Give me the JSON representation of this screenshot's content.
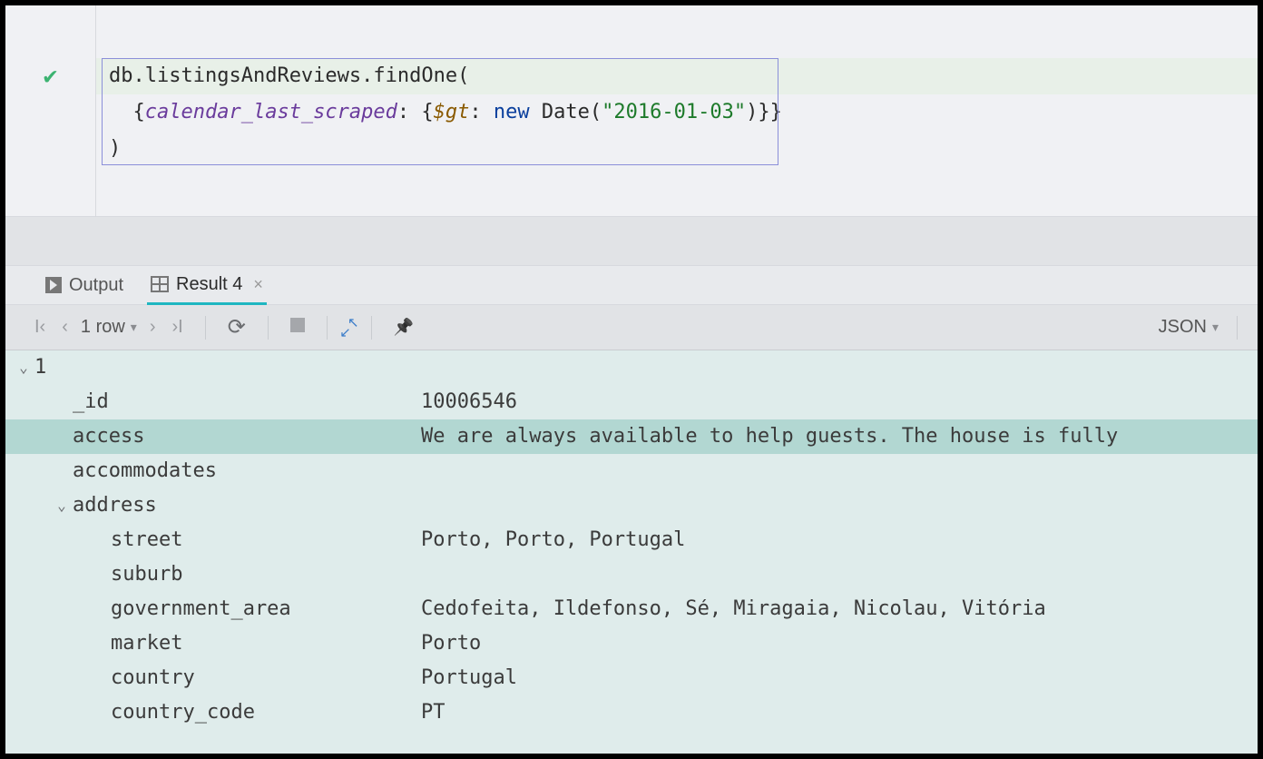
{
  "editor": {
    "code_lines": [
      {
        "segments": [
          {
            "t": "db",
            "c": "tok-id"
          },
          {
            "t": ".",
            "c": "tok-punc"
          },
          {
            "t": "listingsAndReviews",
            "c": "tok-id"
          },
          {
            "t": ".",
            "c": "tok-punc"
          },
          {
            "t": "findOne",
            "c": "tok-method"
          },
          {
            "t": "(",
            "c": "tok-punc"
          }
        ],
        "highlight": true
      },
      {
        "segments": [
          {
            "t": "  {",
            "c": "tok-punc"
          },
          {
            "t": "calendar_last_scraped",
            "c": "tok-field"
          },
          {
            "t": ": {",
            "c": "tok-punc"
          },
          {
            "t": "$gt",
            "c": "tok-op"
          },
          {
            "t": ": ",
            "c": "tok-punc"
          },
          {
            "t": "new ",
            "c": "tok-kw"
          },
          {
            "t": "Date",
            "c": "tok-call"
          },
          {
            "t": "(",
            "c": "tok-punc"
          },
          {
            "t": "\"2016-01-03\"",
            "c": "tok-str"
          },
          {
            "t": ")}}",
            "c": "tok-punc"
          }
        ],
        "highlight": false
      },
      {
        "segments": [
          {
            "t": ")",
            "c": "tok-punc"
          }
        ],
        "highlight": false
      }
    ]
  },
  "tabs": {
    "output_label": "Output",
    "result_label": "Result 4"
  },
  "toolbar": {
    "row_count_label": "1 row",
    "view_mode": "JSON"
  },
  "tree": {
    "root_index": "1",
    "rows": [
      {
        "indent": 1,
        "key": "_id",
        "value": "10006546",
        "selected": false
      },
      {
        "indent": 1,
        "key": "access",
        "value": "We are always available to help guests. The house is fully",
        "selected": true
      },
      {
        "indent": 1,
        "key": "accommodates",
        "value": "",
        "selected": false
      },
      {
        "indent": 1,
        "key": "address",
        "value": "",
        "selected": false,
        "expander": "open"
      },
      {
        "indent": 2,
        "key": "street",
        "value": "Porto, Porto, Portugal",
        "selected": false
      },
      {
        "indent": 2,
        "key": "suburb",
        "value": "",
        "selected": false
      },
      {
        "indent": 2,
        "key": "government_area",
        "value": "Cedofeita, Ildefonso, Sé, Miragaia, Nicolau, Vitória",
        "selected": false
      },
      {
        "indent": 2,
        "key": "market",
        "value": "Porto",
        "selected": false
      },
      {
        "indent": 2,
        "key": "country",
        "value": "Portugal",
        "selected": false
      },
      {
        "indent": 2,
        "key": "country_code",
        "value": "PT",
        "selected": false
      }
    ]
  }
}
